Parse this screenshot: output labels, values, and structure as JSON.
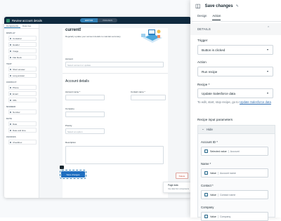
{
  "editor": {
    "title": "Review account details",
    "mode_tabs": [
      "EDITOR",
      "PREVIEW"
    ],
    "left_tabs": [
      "Components",
      "Data tree"
    ],
    "sections": [
      {
        "heading": "DISPLAY",
        "items": [
          "Container",
          "Header",
          "Image",
          "Flat block"
        ]
      },
      {
        "heading": "TEXT",
        "items": [
          "Short answer",
          "Long answer"
        ]
      },
      {
        "heading": "CONTACT",
        "items": [
          "Phone",
          "Email",
          "URL"
        ]
      },
      {
        "heading": "NUMBER",
        "items": [
          "Number"
        ]
      },
      {
        "heading": "DATE",
        "items": [
          "Date",
          "Date and time"
        ]
      },
      {
        "heading": "CHOICES",
        "items": [
          "Checkbox"
        ]
      }
    ],
    "page": {
      "heading": "current!",
      "subtext": "Regularly update your account details to maintain accuracy.",
      "account_label": "Account",
      "account_placeholder": "Select account or update",
      "section_title": "Account details",
      "account_name_label": "Account name *",
      "contact_name_label": "Contact name *",
      "company_label": "Company",
      "priority_label": "Priority",
      "priority_placeholder": "Select an option",
      "description_label": "Description",
      "save_button": "Save changes",
      "delete_button": "Delete"
    },
    "page_data_popup": {
      "title": "Page data",
      "subtitle": "Use data from components"
    }
  },
  "panel": {
    "title": "Save changes",
    "tabs": [
      "Design",
      "Action"
    ],
    "active_tab": "Action",
    "details_heading": "DETAILS",
    "trigger_label": "Trigger",
    "trigger_value": "Button is clicked",
    "action_label": "Action",
    "action_value": "Run recipe",
    "recipe_label": "Recipe *",
    "recipe_value": "Update Salesforce data",
    "hint_text": "To edit, start, stop recipe, go to",
    "hint_link": "Update Salesforce data",
    "params_label": "Recipe input parameters",
    "params_toggle": "Hide",
    "fields": [
      {
        "label": "Account ID *",
        "kind": "Selected value",
        "value": "Account"
      },
      {
        "label": "Name *",
        "kind": "Value",
        "value": "Account name"
      },
      {
        "label": "Contact *",
        "kind": "Value",
        "value": "Contact name"
      },
      {
        "label": "Company",
        "kind": "Value",
        "value": "Company"
      }
    ]
  }
}
